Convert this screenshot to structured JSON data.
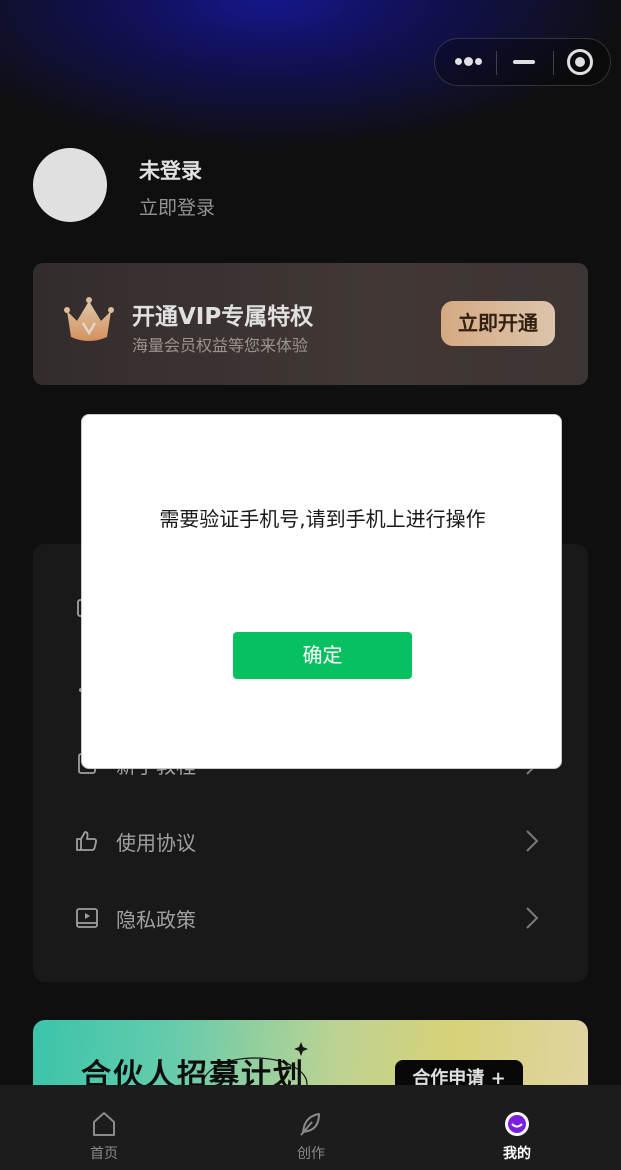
{
  "user": {
    "name": "未登录",
    "login_link": "立即登录"
  },
  "vip": {
    "title": "开通VIP专属特权",
    "subtitle": "海量会员权益等您来体验",
    "button": "立即开通"
  },
  "menu": {
    "items": [
      {
        "label": "",
        "icon": "calendar-icon"
      },
      {
        "label": "",
        "icon": "link-icon"
      },
      {
        "label": "新手教程",
        "icon": "book-icon"
      },
      {
        "label": "使用协议",
        "icon": "thumbs-up-icon"
      },
      {
        "label": "隐私政策",
        "icon": "video-icon"
      }
    ]
  },
  "banner": {
    "title": "合伙人招募计划",
    "button": "合作申请 +"
  },
  "modal": {
    "message": "需要验证手机号,请到手机上进行操作",
    "confirm": "确定"
  },
  "tabbar": {
    "items": [
      {
        "label": "首页",
        "icon": "home-icon",
        "active": false
      },
      {
        "label": "创作",
        "icon": "feather-icon",
        "active": false
      },
      {
        "label": "我的",
        "icon": "profile-icon",
        "active": true
      }
    ]
  },
  "colors": {
    "background": "#121212",
    "vip_button": "#f3c295",
    "confirm_button": "#07c160",
    "profile_accent": "#7a1fe0"
  }
}
